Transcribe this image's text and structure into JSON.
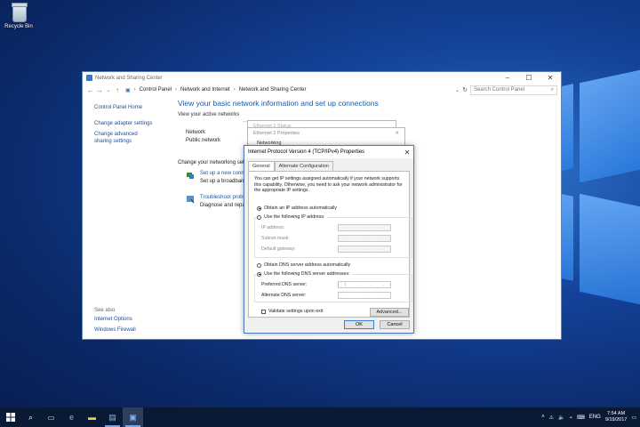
{
  "desktop": {
    "recycle_bin_label": "Recycle Bin"
  },
  "window": {
    "title": "Network and Sharing Center",
    "breadcrumb": [
      "Control Panel",
      "Network and Internet",
      "Network and Sharing Center"
    ],
    "search_placeholder": "Search Control Panel",
    "left_nav": {
      "items": [
        "Control Panel Home",
        "Change adapter settings",
        "Change advanced sharing settings"
      ],
      "see_also": "See also",
      "see_also_items": [
        "Internet Options",
        "Windows Firewall"
      ]
    },
    "heading": "View your basic network information and set up connections",
    "active_networks_label": "View your active networks",
    "network_name": "Network",
    "network_type": "Public network",
    "change_settings_label": "Change your networking sett",
    "setup_link": "Set up a new conn",
    "setup_desc": "Set up a broadban",
    "troubleshoot_link": "Troubleshoot probl",
    "troubleshoot_desc": "Diagnose and repa"
  },
  "ethernet_status_title": "Ethernet 2 Status",
  "ethernet_props_title": "Ethernet 2 Properties",
  "networking_tab": "Networking",
  "dialog": {
    "title": "Internet Protocol Version 4 (TCP/IPv4) Properties",
    "tabs": [
      "General",
      "Alternate Configuration"
    ],
    "intro": "You can get IP settings assigned automatically if your network supports this capability. Otherwise, you need to ask your network administrator for the appropriate IP settings.",
    "obtain_ip_auto": "Obtain an IP address automatically",
    "use_following_ip": "Use the following IP address:",
    "ip_address": "IP address:",
    "subnet_mask": "Subnet mask:",
    "default_gateway": "Default gateway:",
    "obtain_dns_auto": "Obtain DNS server address automatically",
    "use_following_dns": "Use the following DNS server addresses:",
    "preferred_dns": "Preferred DNS server:",
    "alternate_dns": "Alternate DNS server:",
    "validate": "Validate settings upon exit",
    "advanced": "Advanced...",
    "ok": "OK",
    "cancel": "Cancel"
  },
  "taskbar": {
    "language": "ENG",
    "time": "7:54 AM",
    "date": "9/19/2017"
  }
}
